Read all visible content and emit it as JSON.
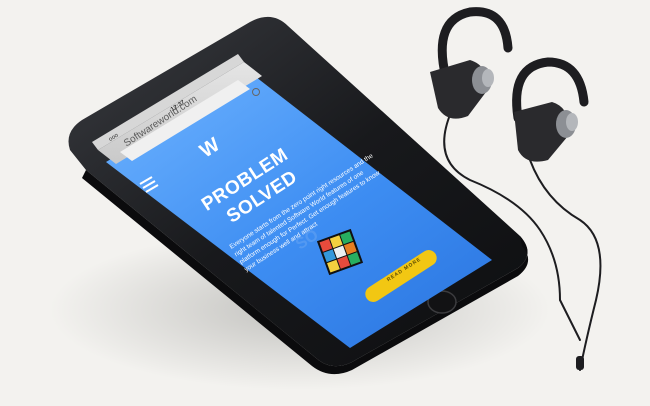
{
  "scene": {
    "background": "#f3f2ef",
    "phone_body": "#1c1d20",
    "screen_accent": "#3d8df2",
    "cta_color": "#f2c713",
    "earphone_color": "#2a2a2d"
  },
  "browser": {
    "carrier": "ooo",
    "time": "12:37",
    "url": "Softwareworld.com"
  },
  "website": {
    "logo": "W",
    "headline_line1": "PROBLEM",
    "headline_line2": "SOLVED",
    "body": "Everyone starts from the zero point right resources and the right team of talented Software World features of one platform enough for Perfect. Get enough features to know your business well and attract",
    "cta_label": "READ MORE"
  },
  "icons": {
    "menu": "hamburger-icon",
    "refresh": "refresh-icon",
    "lock": "lock-icon",
    "home": "home-button-icon",
    "cube": "rubiks-cube-icon"
  }
}
